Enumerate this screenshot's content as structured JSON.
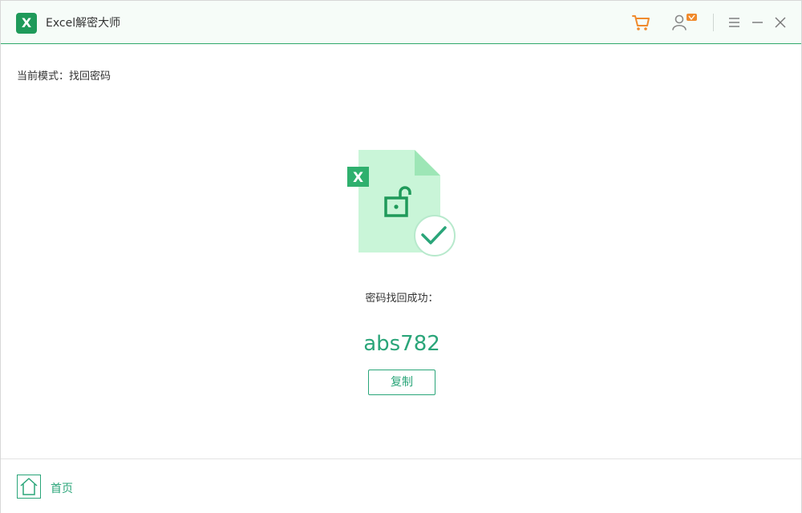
{
  "titlebar": {
    "logo_letter": "X",
    "app_title": "Excel解密大师",
    "icons": [
      "cart-icon",
      "user-vip-icon",
      "menu-icon",
      "minimize-icon",
      "close-icon"
    ]
  },
  "mode": {
    "label": "当前模式：找回密码"
  },
  "result": {
    "file_letter": "X",
    "success_text": "密码找回成功：",
    "password": "abs782",
    "copy_label": "复制"
  },
  "footer": {
    "home_label": "首页"
  },
  "colors": {
    "brand_green": "#1f9a5a",
    "accent_green": "#2aa579",
    "cart_orange": "#f08a2c"
  }
}
